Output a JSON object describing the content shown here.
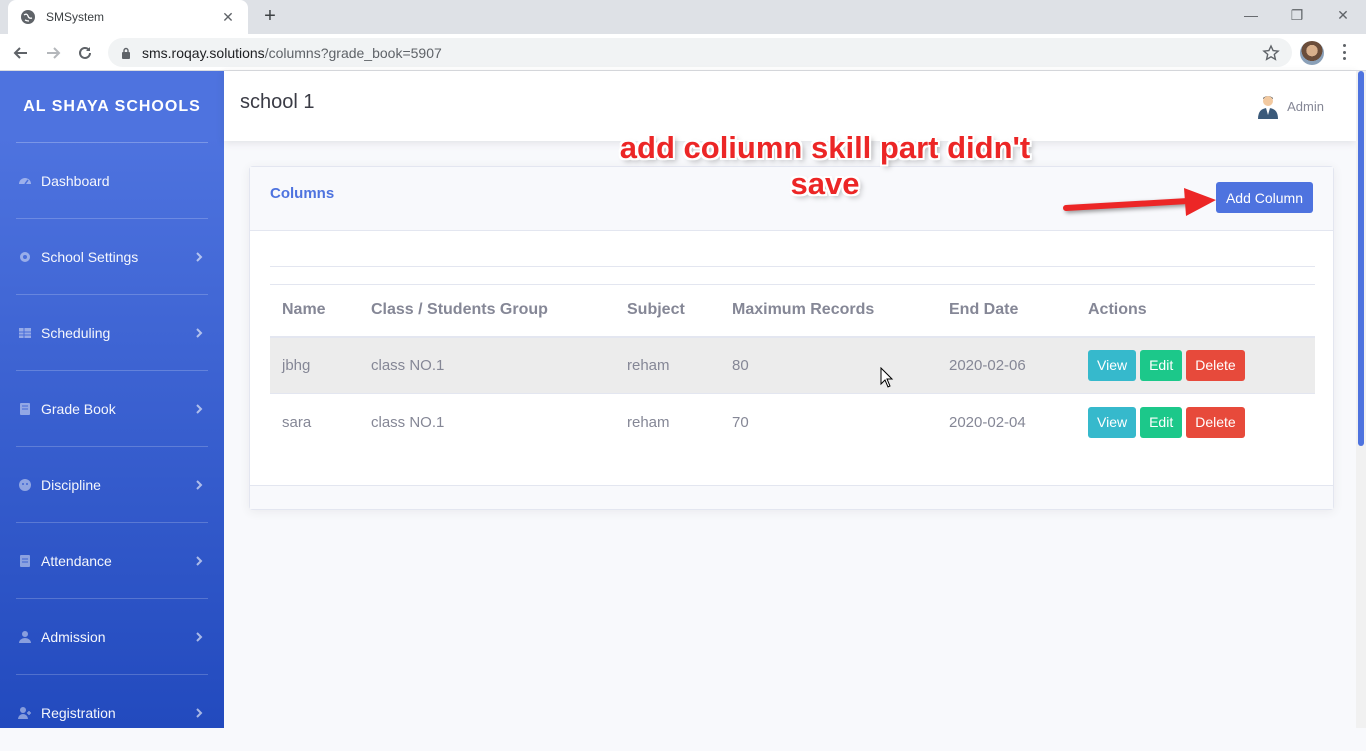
{
  "browser": {
    "tab_title": "SMSystem",
    "new_tab": "+",
    "url_host": "sms.roqay.solutions",
    "url_path": "/columns?grade_book=5907",
    "minimize": "—",
    "restore": "❐",
    "close": "✕"
  },
  "sidebar": {
    "brand": "AL SHAYA SCHOOLS",
    "items": [
      {
        "label": "Dashboard",
        "icon": "dashboard-icon"
      },
      {
        "label": "School Settings",
        "icon": "gear-icon"
      },
      {
        "label": "Scheduling",
        "icon": "table-icon"
      },
      {
        "label": "Grade Book",
        "icon": "book-icon"
      },
      {
        "label": "Discipline",
        "icon": "face-icon"
      },
      {
        "label": "Attendance",
        "icon": "clipboard-icon"
      },
      {
        "label": "Admission",
        "icon": "user-icon"
      },
      {
        "label": "Registration",
        "icon": "user-plus-icon"
      }
    ]
  },
  "topbar": {
    "title": "school 1",
    "user": "Admin"
  },
  "card": {
    "title": "Columns",
    "add_button": "Add Column",
    "table": {
      "headers": [
        "Name",
        "Class / Students Group",
        "Subject",
        "Maximum Records",
        "End Date",
        "Actions"
      ],
      "rows": [
        {
          "name": "jbhg",
          "class": "class NO.1",
          "subject": "reham",
          "max": "80",
          "end": "2020-02-06"
        },
        {
          "name": "sara",
          "class": "class NO.1",
          "subject": "reham",
          "max": "70",
          "end": "2020-02-04"
        }
      ],
      "actions": {
        "view": "View",
        "edit": "Edit",
        "delete": "Delete"
      }
    }
  },
  "annotation": {
    "text": "add coliumn skill part didn't save"
  },
  "colors": {
    "primary": "#4e73df",
    "info": "#36b9cc",
    "success": "#1cc88a",
    "danger": "#e74a3b",
    "annotation": "#ec2626"
  }
}
